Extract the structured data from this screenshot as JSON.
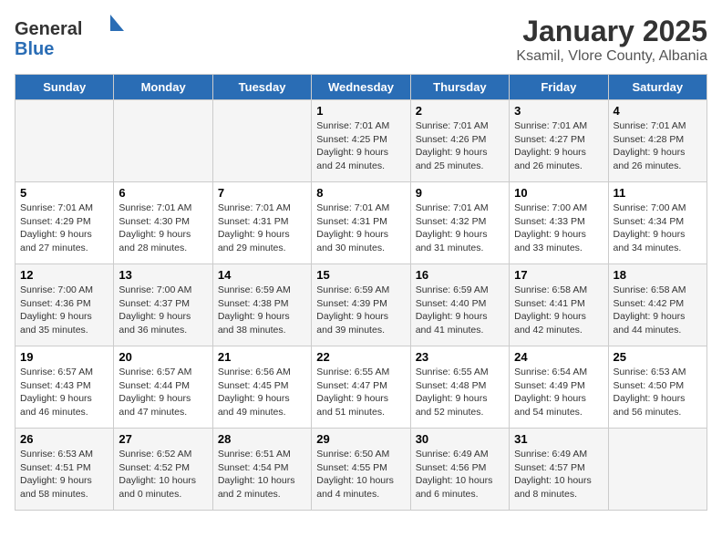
{
  "logo": {
    "text_general": "General",
    "text_blue": "Blue"
  },
  "title": "January 2025",
  "subtitle": "Ksamil, Vlore County, Albania",
  "weekdays": [
    "Sunday",
    "Monday",
    "Tuesday",
    "Wednesday",
    "Thursday",
    "Friday",
    "Saturday"
  ],
  "weeks": [
    [
      {
        "day": "",
        "info": ""
      },
      {
        "day": "",
        "info": ""
      },
      {
        "day": "",
        "info": ""
      },
      {
        "day": "1",
        "info": "Sunrise: 7:01 AM\nSunset: 4:25 PM\nDaylight: 9 hours and 24 minutes."
      },
      {
        "day": "2",
        "info": "Sunrise: 7:01 AM\nSunset: 4:26 PM\nDaylight: 9 hours and 25 minutes."
      },
      {
        "day": "3",
        "info": "Sunrise: 7:01 AM\nSunset: 4:27 PM\nDaylight: 9 hours and 26 minutes."
      },
      {
        "day": "4",
        "info": "Sunrise: 7:01 AM\nSunset: 4:28 PM\nDaylight: 9 hours and 26 minutes."
      }
    ],
    [
      {
        "day": "5",
        "info": "Sunrise: 7:01 AM\nSunset: 4:29 PM\nDaylight: 9 hours and 27 minutes."
      },
      {
        "day": "6",
        "info": "Sunrise: 7:01 AM\nSunset: 4:30 PM\nDaylight: 9 hours and 28 minutes."
      },
      {
        "day": "7",
        "info": "Sunrise: 7:01 AM\nSunset: 4:31 PM\nDaylight: 9 hours and 29 minutes."
      },
      {
        "day": "8",
        "info": "Sunrise: 7:01 AM\nSunset: 4:31 PM\nDaylight: 9 hours and 30 minutes."
      },
      {
        "day": "9",
        "info": "Sunrise: 7:01 AM\nSunset: 4:32 PM\nDaylight: 9 hours and 31 minutes."
      },
      {
        "day": "10",
        "info": "Sunrise: 7:00 AM\nSunset: 4:33 PM\nDaylight: 9 hours and 33 minutes."
      },
      {
        "day": "11",
        "info": "Sunrise: 7:00 AM\nSunset: 4:34 PM\nDaylight: 9 hours and 34 minutes."
      }
    ],
    [
      {
        "day": "12",
        "info": "Sunrise: 7:00 AM\nSunset: 4:36 PM\nDaylight: 9 hours and 35 minutes."
      },
      {
        "day": "13",
        "info": "Sunrise: 7:00 AM\nSunset: 4:37 PM\nDaylight: 9 hours and 36 minutes."
      },
      {
        "day": "14",
        "info": "Sunrise: 6:59 AM\nSunset: 4:38 PM\nDaylight: 9 hours and 38 minutes."
      },
      {
        "day": "15",
        "info": "Sunrise: 6:59 AM\nSunset: 4:39 PM\nDaylight: 9 hours and 39 minutes."
      },
      {
        "day": "16",
        "info": "Sunrise: 6:59 AM\nSunset: 4:40 PM\nDaylight: 9 hours and 41 minutes."
      },
      {
        "day": "17",
        "info": "Sunrise: 6:58 AM\nSunset: 4:41 PM\nDaylight: 9 hours and 42 minutes."
      },
      {
        "day": "18",
        "info": "Sunrise: 6:58 AM\nSunset: 4:42 PM\nDaylight: 9 hours and 44 minutes."
      }
    ],
    [
      {
        "day": "19",
        "info": "Sunrise: 6:57 AM\nSunset: 4:43 PM\nDaylight: 9 hours and 46 minutes."
      },
      {
        "day": "20",
        "info": "Sunrise: 6:57 AM\nSunset: 4:44 PM\nDaylight: 9 hours and 47 minutes."
      },
      {
        "day": "21",
        "info": "Sunrise: 6:56 AM\nSunset: 4:45 PM\nDaylight: 9 hours and 49 minutes."
      },
      {
        "day": "22",
        "info": "Sunrise: 6:55 AM\nSunset: 4:47 PM\nDaylight: 9 hours and 51 minutes."
      },
      {
        "day": "23",
        "info": "Sunrise: 6:55 AM\nSunset: 4:48 PM\nDaylight: 9 hours and 52 minutes."
      },
      {
        "day": "24",
        "info": "Sunrise: 6:54 AM\nSunset: 4:49 PM\nDaylight: 9 hours and 54 minutes."
      },
      {
        "day": "25",
        "info": "Sunrise: 6:53 AM\nSunset: 4:50 PM\nDaylight: 9 hours and 56 minutes."
      }
    ],
    [
      {
        "day": "26",
        "info": "Sunrise: 6:53 AM\nSunset: 4:51 PM\nDaylight: 9 hours and 58 minutes."
      },
      {
        "day": "27",
        "info": "Sunrise: 6:52 AM\nSunset: 4:52 PM\nDaylight: 10 hours and 0 minutes."
      },
      {
        "day": "28",
        "info": "Sunrise: 6:51 AM\nSunset: 4:54 PM\nDaylight: 10 hours and 2 minutes."
      },
      {
        "day": "29",
        "info": "Sunrise: 6:50 AM\nSunset: 4:55 PM\nDaylight: 10 hours and 4 minutes."
      },
      {
        "day": "30",
        "info": "Sunrise: 6:49 AM\nSunset: 4:56 PM\nDaylight: 10 hours and 6 minutes."
      },
      {
        "day": "31",
        "info": "Sunrise: 6:49 AM\nSunset: 4:57 PM\nDaylight: 10 hours and 8 minutes."
      },
      {
        "day": "",
        "info": ""
      }
    ]
  ]
}
